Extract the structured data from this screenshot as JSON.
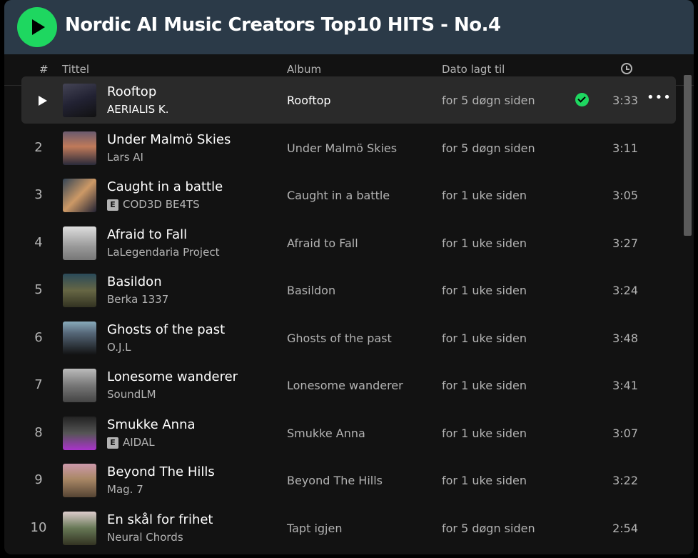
{
  "playlist": {
    "title": "Nordic AI Music Creators Top10 HITS - No.4",
    "accent_color": "#1ed760"
  },
  "columns": {
    "number": "#",
    "title": "Tittel",
    "album": "Album",
    "date_added": "Dato lagt til",
    "duration_icon": "clock-icon"
  },
  "tracks": [
    {
      "num": "1",
      "name": "Rooftop",
      "artist": "AERIALIS K.",
      "album": "Rooftop",
      "date": "for 5 døgn siden",
      "duration": "3:33",
      "explicit": false,
      "active": true,
      "saved": true
    },
    {
      "num": "2",
      "name": "Under Malmö Skies",
      "artist": "Lars AI",
      "album": "Under Malmö Skies",
      "date": "for 5 døgn siden",
      "duration": "3:11",
      "explicit": false
    },
    {
      "num": "3",
      "name": "Caught in a battle",
      "artist": "COD3D BE4TS",
      "album": "Caught in a battle",
      "date": "for 1 uke siden",
      "duration": "3:05",
      "explicit": true
    },
    {
      "num": "4",
      "name": "Afraid to Fall",
      "artist": "LaLegendaria Project",
      "album": "Afraid to Fall",
      "date": "for 1 uke siden",
      "duration": "3:27",
      "explicit": false
    },
    {
      "num": "5",
      "name": "Basildon",
      "artist": "Berka 1337",
      "album": "Basildon",
      "date": "for 1 uke siden",
      "duration": "3:24",
      "explicit": false
    },
    {
      "num": "6",
      "name": "Ghosts of the past",
      "artist": "O.J.L",
      "album": "Ghosts of the past",
      "date": "for 1 uke siden",
      "duration": "3:48",
      "explicit": false
    },
    {
      "num": "7",
      "name": "Lonesome wanderer",
      "artist": "SoundLM",
      "album": "Lonesome wanderer",
      "date": "for 1 uke siden",
      "duration": "3:41",
      "explicit": false
    },
    {
      "num": "8",
      "name": "Smukke Anna",
      "artist": "AIDAL",
      "album": "Smukke Anna",
      "date": "for 1 uke siden",
      "duration": "3:07",
      "explicit": true
    },
    {
      "num": "9",
      "name": "Beyond The Hills",
      "artist": "Mag. 7",
      "album": "Beyond The Hills",
      "date": "for 1 uke siden",
      "duration": "3:22",
      "explicit": false
    },
    {
      "num": "10",
      "name": "En skål for frihet",
      "artist": "Neural Chords",
      "album": "Tapt igjen",
      "date": "for 5 døgn siden",
      "duration": "2:54",
      "explicit": false
    }
  ],
  "explicit_label": "E",
  "more_label": "•••"
}
